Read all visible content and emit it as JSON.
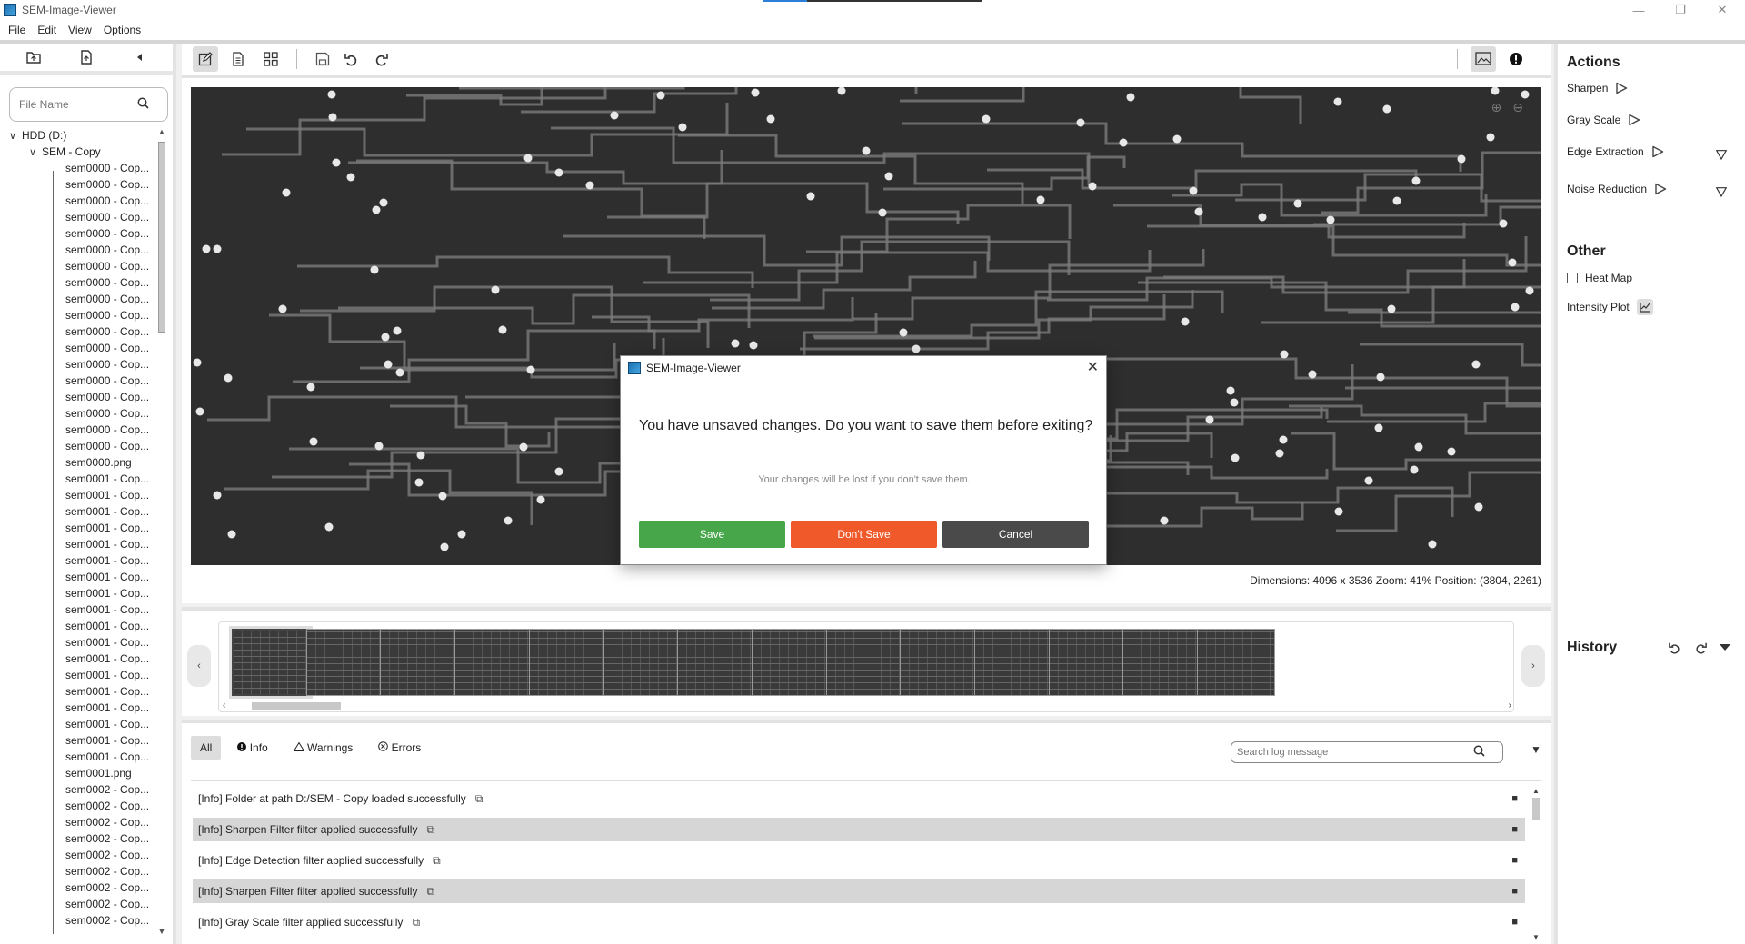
{
  "window": {
    "title": "SEM-Image-Viewer",
    "minimize": "—",
    "maximize": "❐",
    "close": "✕"
  },
  "menu": [
    "File",
    "Edit",
    "View",
    "Options"
  ],
  "left": {
    "search_placeholder": "File Name",
    "tree_root": "HDD (D:)",
    "tree_folder": "SEM - Copy",
    "files": [
      "sem0000 - Cop...",
      "sem0000 - Cop...",
      "sem0000 - Cop...",
      "sem0000 - Cop...",
      "sem0000 - Cop...",
      "sem0000 - Cop...",
      "sem0000 - Cop...",
      "sem0000 - Cop...",
      "sem0000 - Cop...",
      "sem0000 - Cop...",
      "sem0000 - Cop...",
      "sem0000 - Cop...",
      "sem0000 - Cop...",
      "sem0000 - Cop...",
      "sem0000 - Cop...",
      "sem0000 - Cop...",
      "sem0000 - Cop...",
      "sem0000 - Cop...",
      "sem0000.png",
      "sem0001 - Cop...",
      "sem0001 - Cop...",
      "sem0001 - Cop...",
      "sem0001 - Cop...",
      "sem0001 - Cop...",
      "sem0001 - Cop...",
      "sem0001 - Cop...",
      "sem0001 - Cop...",
      "sem0001 - Cop...",
      "sem0001 - Cop...",
      "sem0001 - Cop...",
      "sem0001 - Cop...",
      "sem0001 - Cop...",
      "sem0001 - Cop...",
      "sem0001 - Cop...",
      "sem0001 - Cop...",
      "sem0001 - Cop...",
      "sem0001 - Cop...",
      "sem0001.png",
      "sem0002 - Cop...",
      "sem0002 - Cop...",
      "sem0002 - Cop...",
      "sem0002 - Cop...",
      "sem0002 - Cop...",
      "sem0002 - Cop...",
      "sem0002 - Cop...",
      "sem0002 - Cop...",
      "sem0002 - Cop..."
    ]
  },
  "image": {
    "info": "Dimensions: 4096 x 3536  Zoom: 41%  Position: (3804, 2261)"
  },
  "log": {
    "tabs": [
      "All",
      "Info",
      "Warnings",
      "Errors"
    ],
    "search_placeholder": "Search log message",
    "entries": [
      "[Info] Folder at path D:/SEM - Copy loaded successfully",
      "[Info] Sharpen Filter filter applied successfully",
      "[Info] Edge Detection filter applied successfully",
      "[Info] Sharpen Filter filter applied successfully",
      "[Info] Gray Scale filter applied successfully"
    ]
  },
  "right": {
    "actions_title": "Actions",
    "actions": [
      "Sharpen",
      "Gray Scale",
      "Edge Extraction",
      "Noise Reduction"
    ],
    "other_title": "Other",
    "heat_map": "Heat Map",
    "intensity_plot": "Intensity Plot",
    "history_title": "History"
  },
  "dialog": {
    "title": "SEM-Image-Viewer",
    "message": "You have unsaved changes. Do you want to save them before exiting?",
    "sub": "Your changes will be lost if you don't save them.",
    "save": "Save",
    "dont_save": "Don't Save",
    "cancel": "Cancel"
  },
  "colors": {
    "save": "#46a649",
    "dont_save": "#f05a2a",
    "cancel": "#4a4a4a"
  }
}
